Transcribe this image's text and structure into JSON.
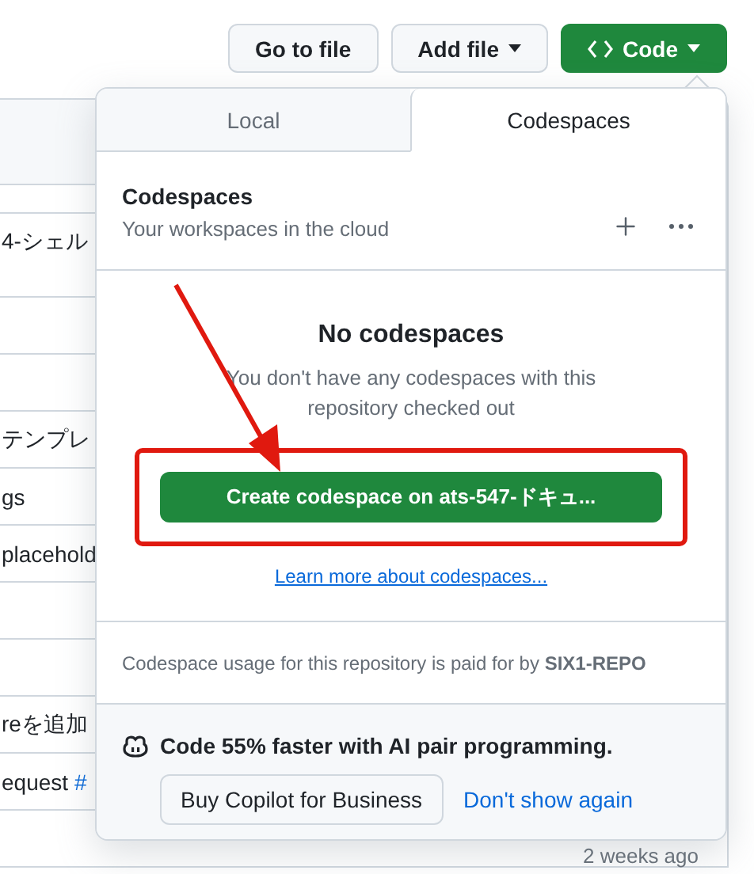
{
  "toolbar": {
    "buttons": [
      {
        "label": "Go to file",
        "kind": "plain"
      },
      {
        "label": "Add file",
        "kind": "dropdown"
      },
      {
        "label": "Code",
        "kind": "primary"
      }
    ]
  },
  "file_list": {
    "rows": [
      {
        "text": "4-シェル"
      },
      {},
      {},
      {
        "text": "テンプレ"
      },
      {
        "text": "gs"
      },
      {
        "text": "placehold"
      },
      {},
      {},
      {
        "text": "reを追加"
      },
      {
        "text": "equest ",
        "link": "#"
      },
      {
        "time": "2 weeks ago"
      }
    ]
  },
  "code_menu": {
    "tabs": [
      {
        "label": "Local",
        "selected": false
      },
      {
        "label": "Codespaces",
        "selected": true
      }
    ],
    "header": {
      "title": "Codespaces",
      "subtitle": "Your workspaces in the cloud"
    },
    "empty_state": {
      "title": "No codespaces",
      "description": "You don't have any codespaces with this repository checked out",
      "create_button": "Create codespace on ats-547-ドキュ...",
      "learn_link": "Learn more about codespaces..."
    },
    "billing_note": {
      "text": "Codespace usage for this repository is paid for by ",
      "owner": "SIX1-REPO"
    },
    "copilot_promo": {
      "text": "Code 55% faster with AI pair programming.",
      "buy_button": "Buy Copilot for Business",
      "dismiss_link": "Don't show again"
    }
  },
  "annotation": {
    "kind": "arrow"
  }
}
